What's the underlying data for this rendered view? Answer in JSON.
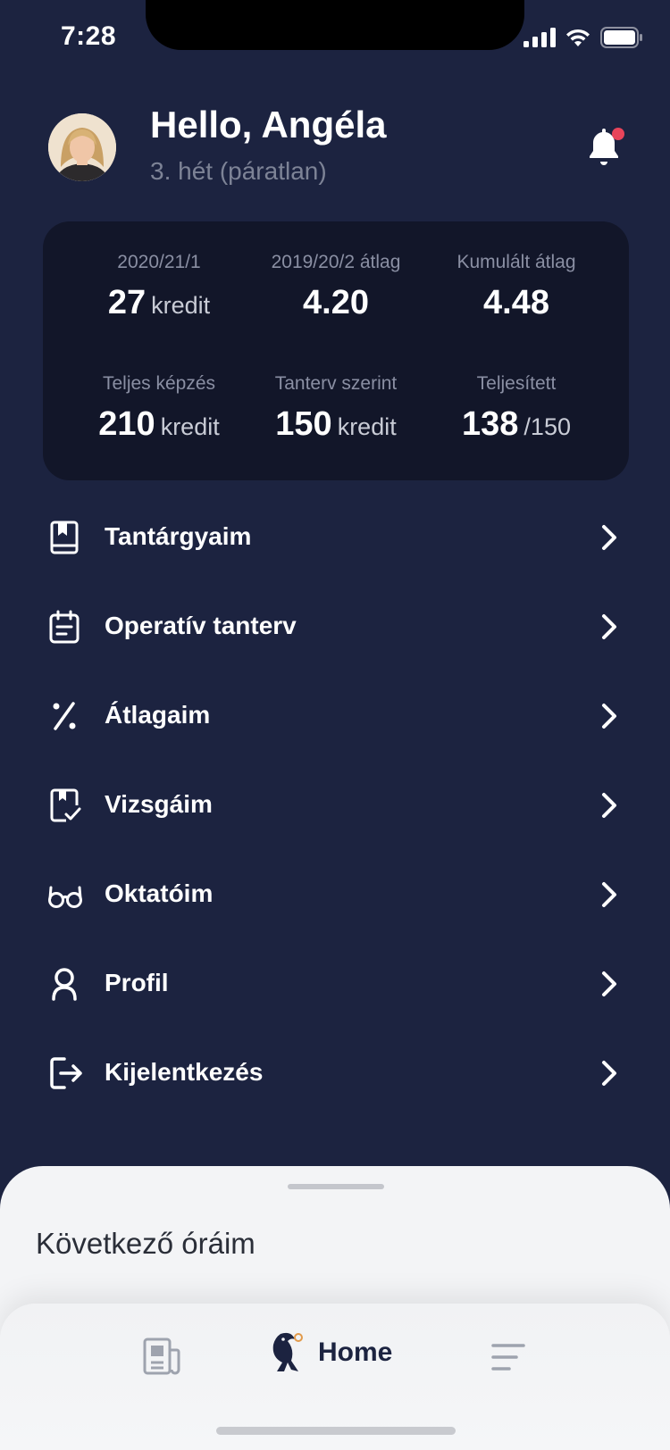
{
  "status_bar": {
    "time": "7:28"
  },
  "header": {
    "greeting": "Hello, Angéla",
    "week": "3. hét (páratlan)"
  },
  "stats": [
    {
      "label": "2020/21/1",
      "value": "27",
      "unit": "kredit"
    },
    {
      "label": "2019/20/2 átlag",
      "value": "4.20",
      "unit": ""
    },
    {
      "label": "Kumulált átlag",
      "value": "4.48",
      "unit": ""
    },
    {
      "label": "Teljes képzés",
      "value": "210",
      "unit": "kredit"
    },
    {
      "label": "Tanterv szerint",
      "value": "150",
      "unit": "kredit"
    },
    {
      "label": "Teljesített",
      "value": "138",
      "unit": "/150"
    }
  ],
  "menu": [
    {
      "label": "Tantárgyaim",
      "icon": "book-icon"
    },
    {
      "label": "Operatív tanterv",
      "icon": "clipboard-icon"
    },
    {
      "label": "Átlagaim",
      "icon": "percent-icon"
    },
    {
      "label": "Vizsgáim",
      "icon": "exam-check-icon"
    },
    {
      "label": "Oktatóim",
      "icon": "glasses-icon"
    },
    {
      "label": "Profil",
      "icon": "user-icon"
    },
    {
      "label": "Kijelentkezés",
      "icon": "logout-icon"
    }
  ],
  "sheet": {
    "title": "Következő óráim"
  },
  "tabbar": {
    "home_label": "Home"
  },
  "colors": {
    "background": "#1c2340",
    "card": "#121629",
    "notification_dot": "#e8445a",
    "sheet": "#f3f4f6"
  }
}
